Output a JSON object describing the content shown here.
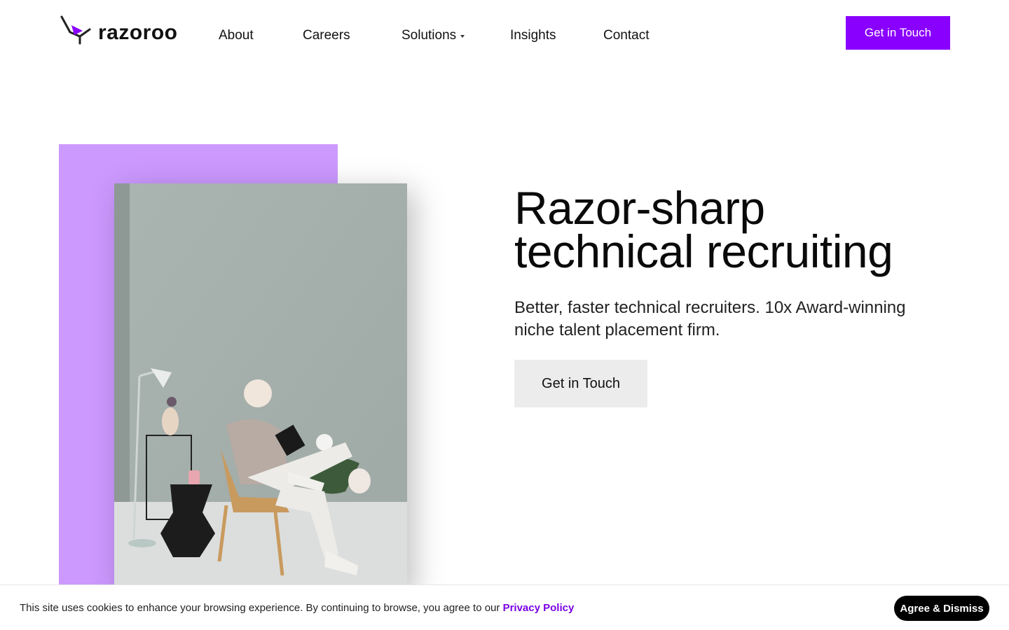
{
  "header": {
    "logo_text": "razoroo",
    "nav": {
      "about": "About",
      "careers": "Careers",
      "solutions": "Solutions",
      "insights": "Insights",
      "contact": "Contact"
    },
    "cta_label": "Get in Touch"
  },
  "hero": {
    "title_line1": "Razor-sharp",
    "title_line2": "technical recruiting",
    "subtitle": "Better, faster technical recruiters. 10x Award-winning niche talent placement firm.",
    "cta_label": "Get in Touch"
  },
  "cookie": {
    "text": "This site uses cookies to enhance your browsing experience. By continuing to browse, you agree to our ",
    "link_label": "Privacy Policy",
    "button_label": "Agree & Dismiss"
  },
  "colors": {
    "brand_purple": "#8a00ff",
    "accent_lilac": "#cc99ff",
    "cookie_link": "#7a00e6"
  }
}
